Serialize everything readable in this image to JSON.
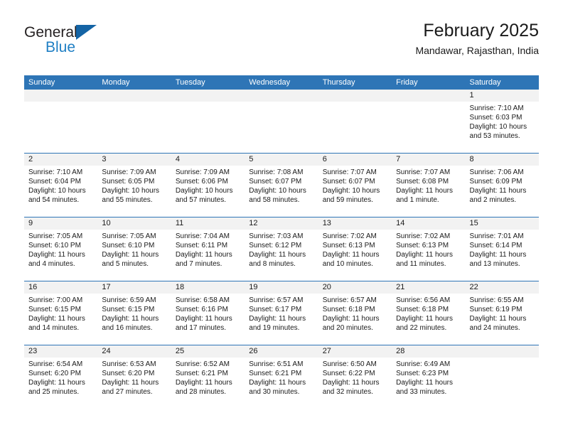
{
  "brand": {
    "name_top": "General",
    "name_bottom": "Blue",
    "triangle_color": "#1464a5",
    "text_color": "#1f7fc4"
  },
  "header": {
    "title": "February 2025",
    "subtitle": "Mandawar, Rajasthan, India"
  },
  "theme": {
    "header_bar": "#2e75b6",
    "daynum_bg": "#f2f2f2",
    "text": "#1a1a1a"
  },
  "weekdays": [
    "Sunday",
    "Monday",
    "Tuesday",
    "Wednesday",
    "Thursday",
    "Friday",
    "Saturday"
  ],
  "weeks": [
    [
      {
        "day": "",
        "empty": true,
        "sunrise": "",
        "sunset": "",
        "daylight_1": "",
        "daylight_2": ""
      },
      {
        "day": "",
        "empty": true,
        "sunrise": "",
        "sunset": "",
        "daylight_1": "",
        "daylight_2": ""
      },
      {
        "day": "",
        "empty": true,
        "sunrise": "",
        "sunset": "",
        "daylight_1": "",
        "daylight_2": ""
      },
      {
        "day": "",
        "empty": true,
        "sunrise": "",
        "sunset": "",
        "daylight_1": "",
        "daylight_2": ""
      },
      {
        "day": "",
        "empty": true,
        "sunrise": "",
        "sunset": "",
        "daylight_1": "",
        "daylight_2": ""
      },
      {
        "day": "",
        "empty": true,
        "sunrise": "",
        "sunset": "",
        "daylight_1": "",
        "daylight_2": ""
      },
      {
        "day": "1",
        "empty": false,
        "sunrise": "Sunrise: 7:10 AM",
        "sunset": "Sunset: 6:03 PM",
        "daylight_1": "Daylight: 10 hours",
        "daylight_2": "and 53 minutes."
      }
    ],
    [
      {
        "day": "2",
        "empty": false,
        "sunrise": "Sunrise: 7:10 AM",
        "sunset": "Sunset: 6:04 PM",
        "daylight_1": "Daylight: 10 hours",
        "daylight_2": "and 54 minutes."
      },
      {
        "day": "3",
        "empty": false,
        "sunrise": "Sunrise: 7:09 AM",
        "sunset": "Sunset: 6:05 PM",
        "daylight_1": "Daylight: 10 hours",
        "daylight_2": "and 55 minutes."
      },
      {
        "day": "4",
        "empty": false,
        "sunrise": "Sunrise: 7:09 AM",
        "sunset": "Sunset: 6:06 PM",
        "daylight_1": "Daylight: 10 hours",
        "daylight_2": "and 57 minutes."
      },
      {
        "day": "5",
        "empty": false,
        "sunrise": "Sunrise: 7:08 AM",
        "sunset": "Sunset: 6:07 PM",
        "daylight_1": "Daylight: 10 hours",
        "daylight_2": "and 58 minutes."
      },
      {
        "day": "6",
        "empty": false,
        "sunrise": "Sunrise: 7:07 AM",
        "sunset": "Sunset: 6:07 PM",
        "daylight_1": "Daylight: 10 hours",
        "daylight_2": "and 59 minutes."
      },
      {
        "day": "7",
        "empty": false,
        "sunrise": "Sunrise: 7:07 AM",
        "sunset": "Sunset: 6:08 PM",
        "daylight_1": "Daylight: 11 hours",
        "daylight_2": "and 1 minute."
      },
      {
        "day": "8",
        "empty": false,
        "sunrise": "Sunrise: 7:06 AM",
        "sunset": "Sunset: 6:09 PM",
        "daylight_1": "Daylight: 11 hours",
        "daylight_2": "and 2 minutes."
      }
    ],
    [
      {
        "day": "9",
        "empty": false,
        "sunrise": "Sunrise: 7:05 AM",
        "sunset": "Sunset: 6:10 PM",
        "daylight_1": "Daylight: 11 hours",
        "daylight_2": "and 4 minutes."
      },
      {
        "day": "10",
        "empty": false,
        "sunrise": "Sunrise: 7:05 AM",
        "sunset": "Sunset: 6:10 PM",
        "daylight_1": "Daylight: 11 hours",
        "daylight_2": "and 5 minutes."
      },
      {
        "day": "11",
        "empty": false,
        "sunrise": "Sunrise: 7:04 AM",
        "sunset": "Sunset: 6:11 PM",
        "daylight_1": "Daylight: 11 hours",
        "daylight_2": "and 7 minutes."
      },
      {
        "day": "12",
        "empty": false,
        "sunrise": "Sunrise: 7:03 AM",
        "sunset": "Sunset: 6:12 PM",
        "daylight_1": "Daylight: 11 hours",
        "daylight_2": "and 8 minutes."
      },
      {
        "day": "13",
        "empty": false,
        "sunrise": "Sunrise: 7:02 AM",
        "sunset": "Sunset: 6:13 PM",
        "daylight_1": "Daylight: 11 hours",
        "daylight_2": "and 10 minutes."
      },
      {
        "day": "14",
        "empty": false,
        "sunrise": "Sunrise: 7:02 AM",
        "sunset": "Sunset: 6:13 PM",
        "daylight_1": "Daylight: 11 hours",
        "daylight_2": "and 11 minutes."
      },
      {
        "day": "15",
        "empty": false,
        "sunrise": "Sunrise: 7:01 AM",
        "sunset": "Sunset: 6:14 PM",
        "daylight_1": "Daylight: 11 hours",
        "daylight_2": "and 13 minutes."
      }
    ],
    [
      {
        "day": "16",
        "empty": false,
        "sunrise": "Sunrise: 7:00 AM",
        "sunset": "Sunset: 6:15 PM",
        "daylight_1": "Daylight: 11 hours",
        "daylight_2": "and 14 minutes."
      },
      {
        "day": "17",
        "empty": false,
        "sunrise": "Sunrise: 6:59 AM",
        "sunset": "Sunset: 6:15 PM",
        "daylight_1": "Daylight: 11 hours",
        "daylight_2": "and 16 minutes."
      },
      {
        "day": "18",
        "empty": false,
        "sunrise": "Sunrise: 6:58 AM",
        "sunset": "Sunset: 6:16 PM",
        "daylight_1": "Daylight: 11 hours",
        "daylight_2": "and 17 minutes."
      },
      {
        "day": "19",
        "empty": false,
        "sunrise": "Sunrise: 6:57 AM",
        "sunset": "Sunset: 6:17 PM",
        "daylight_1": "Daylight: 11 hours",
        "daylight_2": "and 19 minutes."
      },
      {
        "day": "20",
        "empty": false,
        "sunrise": "Sunrise: 6:57 AM",
        "sunset": "Sunset: 6:18 PM",
        "daylight_1": "Daylight: 11 hours",
        "daylight_2": "and 20 minutes."
      },
      {
        "day": "21",
        "empty": false,
        "sunrise": "Sunrise: 6:56 AM",
        "sunset": "Sunset: 6:18 PM",
        "daylight_1": "Daylight: 11 hours",
        "daylight_2": "and 22 minutes."
      },
      {
        "day": "22",
        "empty": false,
        "sunrise": "Sunrise: 6:55 AM",
        "sunset": "Sunset: 6:19 PM",
        "daylight_1": "Daylight: 11 hours",
        "daylight_2": "and 24 minutes."
      }
    ],
    [
      {
        "day": "23",
        "empty": false,
        "sunrise": "Sunrise: 6:54 AM",
        "sunset": "Sunset: 6:20 PM",
        "daylight_1": "Daylight: 11 hours",
        "daylight_2": "and 25 minutes."
      },
      {
        "day": "24",
        "empty": false,
        "sunrise": "Sunrise: 6:53 AM",
        "sunset": "Sunset: 6:20 PM",
        "daylight_1": "Daylight: 11 hours",
        "daylight_2": "and 27 minutes."
      },
      {
        "day": "25",
        "empty": false,
        "sunrise": "Sunrise: 6:52 AM",
        "sunset": "Sunset: 6:21 PM",
        "daylight_1": "Daylight: 11 hours",
        "daylight_2": "and 28 minutes."
      },
      {
        "day": "26",
        "empty": false,
        "sunrise": "Sunrise: 6:51 AM",
        "sunset": "Sunset: 6:21 PM",
        "daylight_1": "Daylight: 11 hours",
        "daylight_2": "and 30 minutes."
      },
      {
        "day": "27",
        "empty": false,
        "sunrise": "Sunrise: 6:50 AM",
        "sunset": "Sunset: 6:22 PM",
        "daylight_1": "Daylight: 11 hours",
        "daylight_2": "and 32 minutes."
      },
      {
        "day": "28",
        "empty": false,
        "sunrise": "Sunrise: 6:49 AM",
        "sunset": "Sunset: 6:23 PM",
        "daylight_1": "Daylight: 11 hours",
        "daylight_2": "and 33 minutes."
      },
      {
        "day": "",
        "empty": true,
        "sunrise": "",
        "sunset": "",
        "daylight_1": "",
        "daylight_2": ""
      }
    ]
  ]
}
